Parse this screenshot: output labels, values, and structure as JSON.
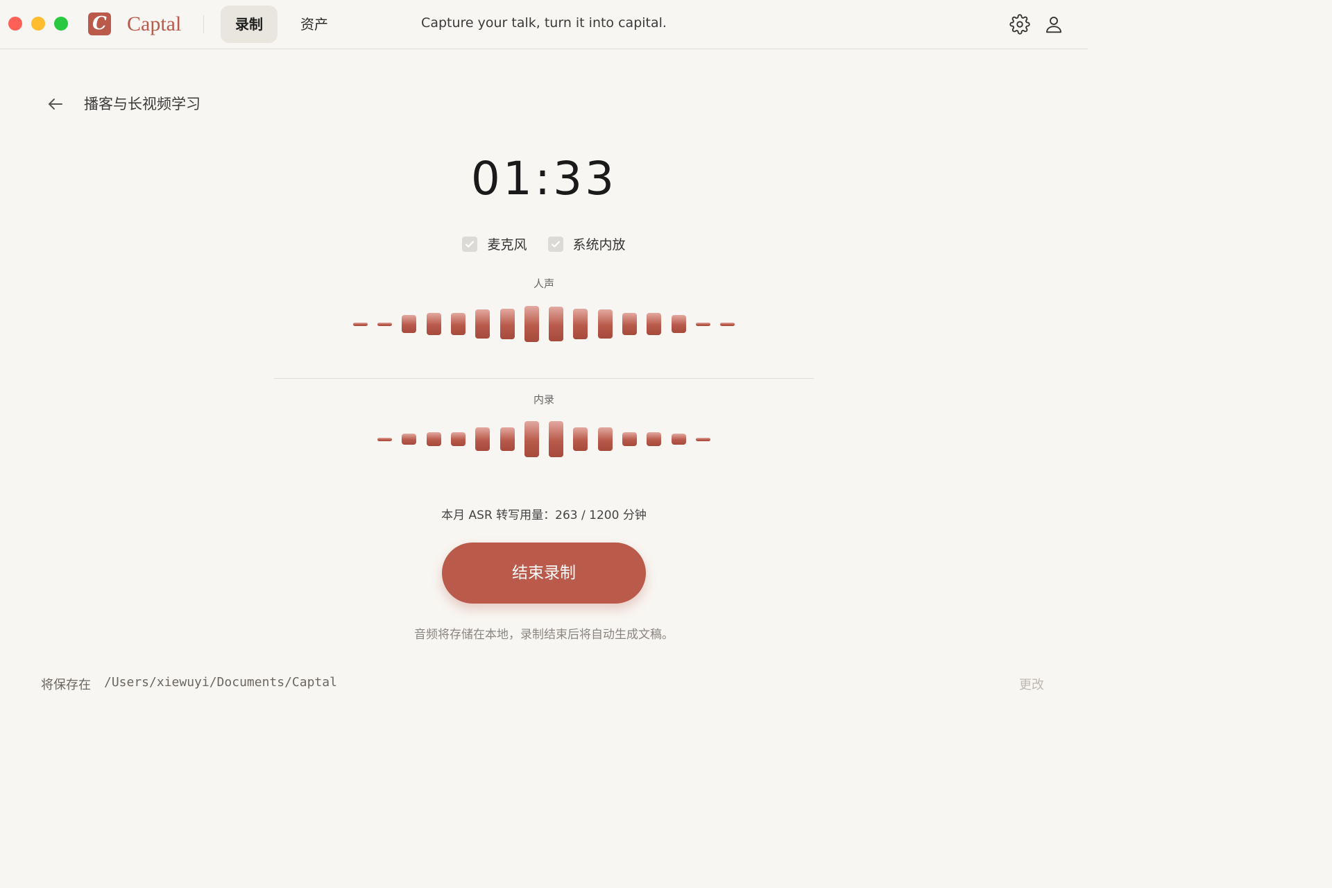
{
  "app": {
    "logo_letter": "C",
    "name": "Captal",
    "tagline": "Capture your talk, turn it into capital.",
    "brand_color": "#b95a4b"
  },
  "nav": {
    "tabs": [
      {
        "label": "录制",
        "active": true
      },
      {
        "label": "资产",
        "active": false
      }
    ]
  },
  "header_icons": [
    "gear-icon",
    "user-icon"
  ],
  "page": {
    "back_icon": "arrow-left-icon",
    "title": "播客与长视频学习"
  },
  "recording": {
    "timer": "01:33",
    "sources": [
      {
        "label": "麦克风",
        "checked": true
      },
      {
        "label": "系统内放",
        "checked": true
      }
    ],
    "meters": [
      {
        "label": "人声",
        "levels": [
          0.08,
          0.08,
          0.5,
          0.6,
          0.6,
          0.8,
          0.85,
          1.0,
          0.95,
          0.85,
          0.8,
          0.6,
          0.6,
          0.5,
          0.08,
          0.08
        ]
      },
      {
        "label": "内录",
        "levels": [
          0.06,
          0.3,
          0.4,
          0.4,
          0.65,
          0.65,
          1.0,
          1.0,
          0.65,
          0.65,
          0.4,
          0.4,
          0.3,
          0.06
        ]
      }
    ],
    "usage": "本月 ASR 转写用量：263 / 1200 分钟",
    "stop_label": "结束录制",
    "note": "音频将存储在本地，录制结束后将自动生成文稿。"
  },
  "storage": {
    "label": "将保存在",
    "path": "/Users/xiewuyi/Documents/Captal",
    "change_label": "更改"
  }
}
